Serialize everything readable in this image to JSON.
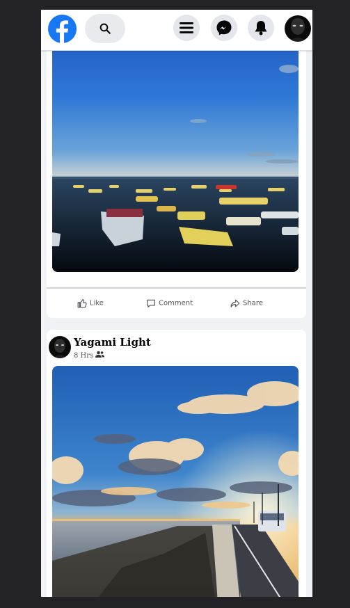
{
  "app": {
    "name": "Facebook",
    "brand_color": "#1877f2"
  },
  "header": {
    "icons": [
      "facebook-logo-icon",
      "search-icon",
      "menu-icon",
      "messenger-icon",
      "bell-icon",
      "avatar"
    ]
  },
  "posts": [
    {
      "image_description": "harbor with small boats at sunset",
      "actions": {
        "like": "Like",
        "comment": "Comment",
        "share": "Share"
      }
    },
    {
      "author": "Yagami Light",
      "time": "8 Hrs",
      "audience_icon": "friends-icon",
      "image_description": "coastal road with bus under dramatic clouds at sunset"
    }
  ]
}
